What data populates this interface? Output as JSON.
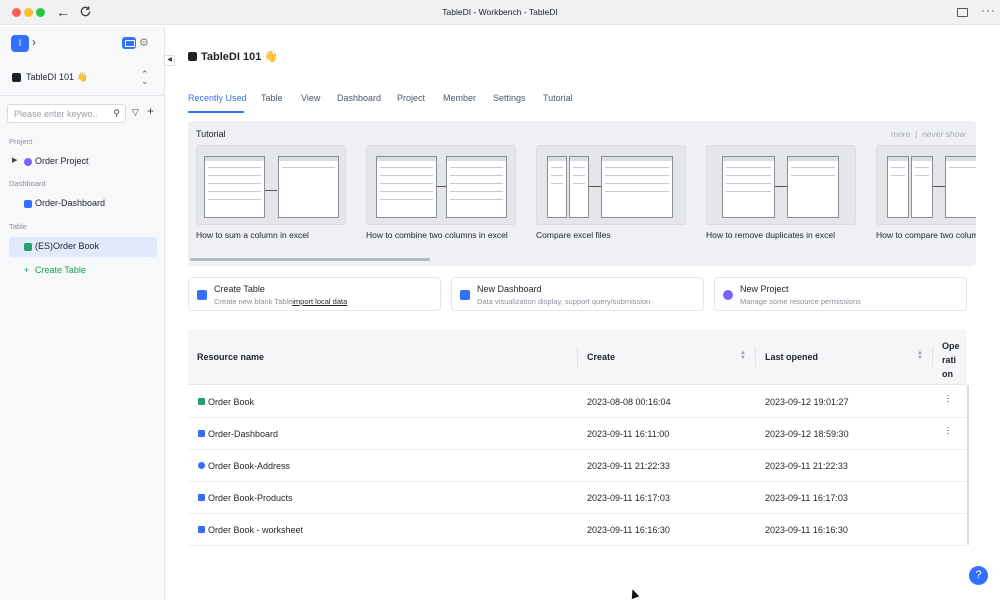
{
  "window": {
    "title": "TableDI - Workbench - TableDI"
  },
  "sidebar": {
    "logo_letter": "I",
    "workspace": "TableDI 101 👋",
    "search_placeholder": "Please enter keywo...",
    "sections": {
      "project": "Project",
      "dashboard": "Dashboard",
      "table": "Table"
    },
    "items": {
      "project": "Order Project",
      "dashboard": "Order-Dashboard",
      "table": "(ES)Order Book",
      "create": "Create Table"
    }
  },
  "main": {
    "title": "TableDI 101 👋",
    "tabs": [
      "Recently Used",
      "Table",
      "View",
      "Dashboard",
      "Project",
      "Member",
      "Settings",
      "Tutorial"
    ],
    "tutorial": {
      "heading": "Tutorial",
      "more": "more",
      "sep": "|",
      "never": "never show",
      "cards": [
        "How to sum a column in excel",
        "How to combine two columns in excel",
        "Compare excel files",
        "How to remove duplicates in excel",
        "How to compare two columns in excel"
      ]
    },
    "quick_actions": [
      {
        "title": "Create Table",
        "desc": "Create new blank Table",
        "link": "import local data",
        "color": "#3370ff"
      },
      {
        "title": "New Dashboard",
        "desc": "Data visualization display, support query/submission",
        "color": "#3370ff"
      },
      {
        "title": "New Project",
        "desc": "Manage some resource permissions",
        "color": "#7b61ff"
      }
    ],
    "table": {
      "headers": {
        "name": "Resource name",
        "create": "Create",
        "opened": "Last opened",
        "op_1": "Ope",
        "op_2": "rati",
        "op_3": "on"
      },
      "rows": [
        {
          "name": "Order Book",
          "create": "2023-08-08 00:16:04",
          "opened": "2023-09-12 19:01:27",
          "color": "#22a06b"
        },
        {
          "name": "Order-Dashboard",
          "create": "2023-09-11 16:11:00",
          "opened": "2023-09-12 18:59:30",
          "color": "#3370ff"
        },
        {
          "name": "Order Book-Address",
          "create": "2023-09-11 21:22:33",
          "opened": "2023-09-11 21:22:33",
          "color": "#3370ff"
        },
        {
          "name": "Order Book-Products",
          "create": "2023-09-11 16:17:03",
          "opened": "2023-09-11 16:17:03",
          "color": "#3370ff"
        },
        {
          "name": "Order Book - worksheet",
          "create": "2023-09-11 16:16:30",
          "opened": "2023-09-11 16:16:30",
          "color": "#3370ff"
        }
      ]
    }
  },
  "help": "?"
}
